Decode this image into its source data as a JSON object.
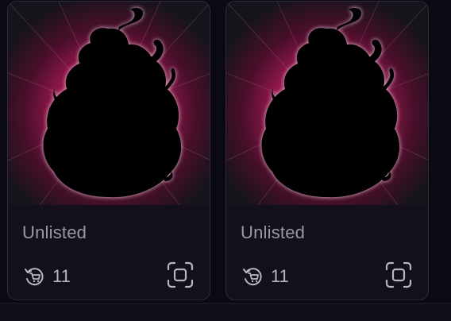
{
  "colors": {
    "card_border": "#2f2a3d",
    "card_bg": "#13101b",
    "glow": "#ff3d8a",
    "text_muted": "#9a97a6"
  },
  "cards": [
    {
      "status": "Unlisted",
      "count": "11",
      "icons": [
        "reload-cart-icon",
        "scan-icon"
      ]
    },
    {
      "status": "Unlisted",
      "count": "11",
      "icons": [
        "reload-cart-icon",
        "scan-icon"
      ]
    }
  ]
}
